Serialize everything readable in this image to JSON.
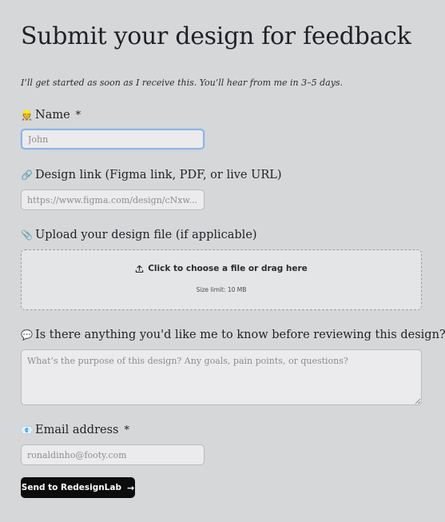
{
  "header": {
    "title": "Submit your design for feedback",
    "subtitle": "I’ll get started as soon as I receive this. You’ll hear from me in 3–5 days."
  },
  "fields": {
    "name": {
      "emoji": "👷",
      "label": "Name",
      "required_mark": "*",
      "placeholder": "John",
      "value": ""
    },
    "design_link": {
      "emoji": "🔗",
      "label": "Design link (Figma link, PDF, or live URL)",
      "placeholder": "https://www.figma.com/design/cNxw...",
      "value": ""
    },
    "upload": {
      "emoji": "📎",
      "label": "Upload your design file (if applicable)",
      "prompt": "Click to choose a file or drag here",
      "size_limit": "Size limit: 10 MB",
      "icon": "upload-icon"
    },
    "notes": {
      "emoji": "💬",
      "label": "Is there anything you'd like me to know before reviewing this design?",
      "placeholder": "What’s the purpose of this design? Any goals, pain points, or questions?",
      "value": ""
    },
    "email": {
      "emoji": "📧",
      "label": "Email address",
      "required_mark": "*",
      "placeholder": "ronaldinho@footy.com",
      "value": ""
    }
  },
  "submit": {
    "label": "Send to RedesignLab",
    "arrow": "→"
  },
  "colors": {
    "background": "#d6d7d9",
    "input_bg": "#ebebed",
    "focus_ring": "#8fb4e0",
    "button_bg": "#0c0c0d",
    "button_text": "#ffffff"
  }
}
